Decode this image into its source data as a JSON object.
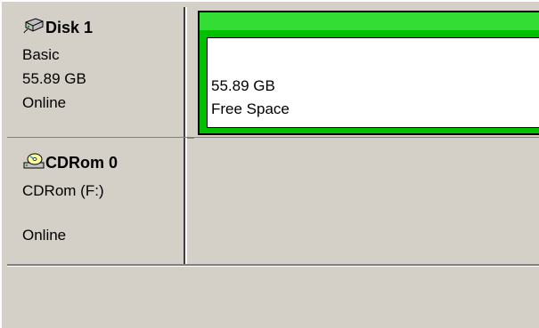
{
  "disks": [
    {
      "icon": "hard-disk-icon",
      "name": "Disk 1",
      "type": "Basic",
      "size": "55.89 GB",
      "status": "Online",
      "volume": {
        "size": "55.89 GB",
        "label": "Free Space",
        "header_color": "#33dd33",
        "border_color": "#00c000"
      }
    },
    {
      "icon": "cdrom-icon",
      "name": "CDRom 0",
      "type": "CDRom (F:)",
      "size": "",
      "status": "Online"
    }
  ]
}
